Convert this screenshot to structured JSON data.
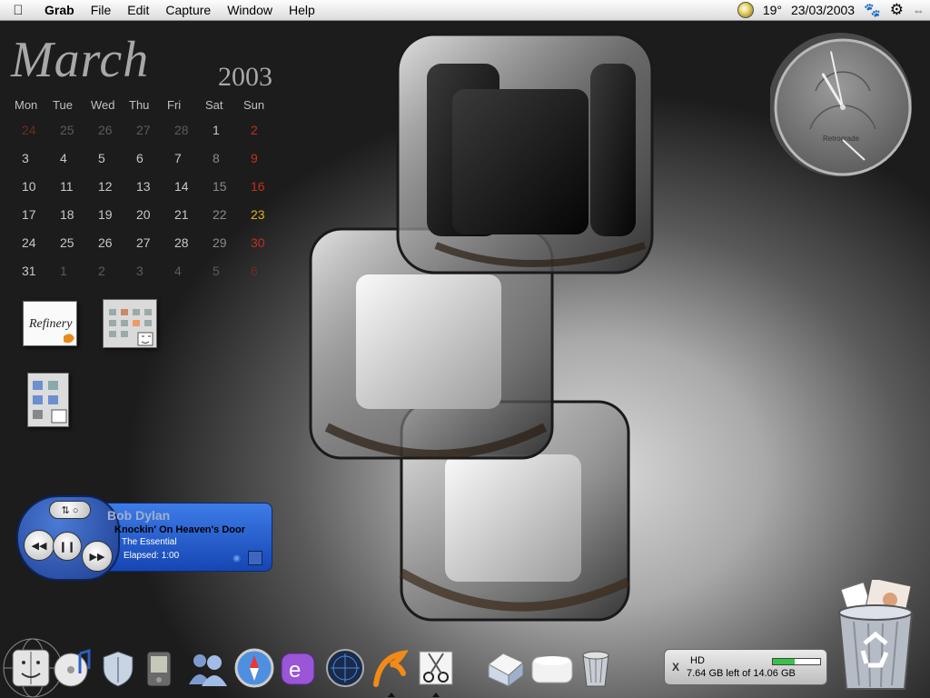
{
  "menubar": {
    "app_name": "Grab",
    "items": [
      "File",
      "Edit",
      "Capture",
      "Window",
      "Help"
    ],
    "temperature": "19°",
    "date": "23/03/2003"
  },
  "calendar": {
    "month": "March",
    "year": "2003",
    "weekdays": [
      "Mon",
      "Tue",
      "Wed",
      "Thu",
      "Fri",
      "Sat",
      "Sun"
    ],
    "days": [
      [
        "24",
        "25",
        "26",
        "27",
        "28",
        "1",
        "2"
      ],
      [
        "3",
        "4",
        "5",
        "6",
        "7",
        "8",
        "9"
      ],
      [
        "10",
        "11",
        "12",
        "13",
        "14",
        "15",
        "16"
      ],
      [
        "17",
        "18",
        "19",
        "20",
        "21",
        "22",
        "23"
      ],
      [
        "24",
        "25",
        "26",
        "27",
        "28",
        "29",
        "30"
      ],
      [
        "31",
        "1",
        "2",
        "3",
        "4",
        "5",
        "6"
      ]
    ],
    "today": "23"
  },
  "desktop_icons": [
    {
      "name": "refinery-icon",
      "label": "Refinery"
    },
    {
      "name": "finder-window-icon"
    },
    {
      "name": "finder-window-icon-2"
    }
  ],
  "clock": {
    "label": "Retrograde",
    "hour": 10,
    "minute": 58
  },
  "itunes": {
    "artist": "Bob Dylan",
    "song": "Knockin' On Heaven's Door",
    "album": "The Essential",
    "elapsed": "Elapsed: 1:00"
  },
  "dock": [
    "finder-icon",
    "itunes-icon",
    "security-shield-icon",
    "palm-icon",
    "ichat-icon",
    "safari-icon",
    "entourage-icon",
    "network-globe-icon",
    "pages-icon",
    "scissors-icon",
    "printer-icon",
    "drive-icon",
    "trash-small-icon"
  ],
  "hd": {
    "title": "HD",
    "free": "7.64 GB left of 14.06 GB",
    "x_label": "X",
    "used_fraction": 0.46
  },
  "colors": {
    "itunes_panel": "#2659d1",
    "hd_bar": "#39c24a",
    "calendar_red": "#c0301f",
    "calendar_today": "#e0b020"
  }
}
